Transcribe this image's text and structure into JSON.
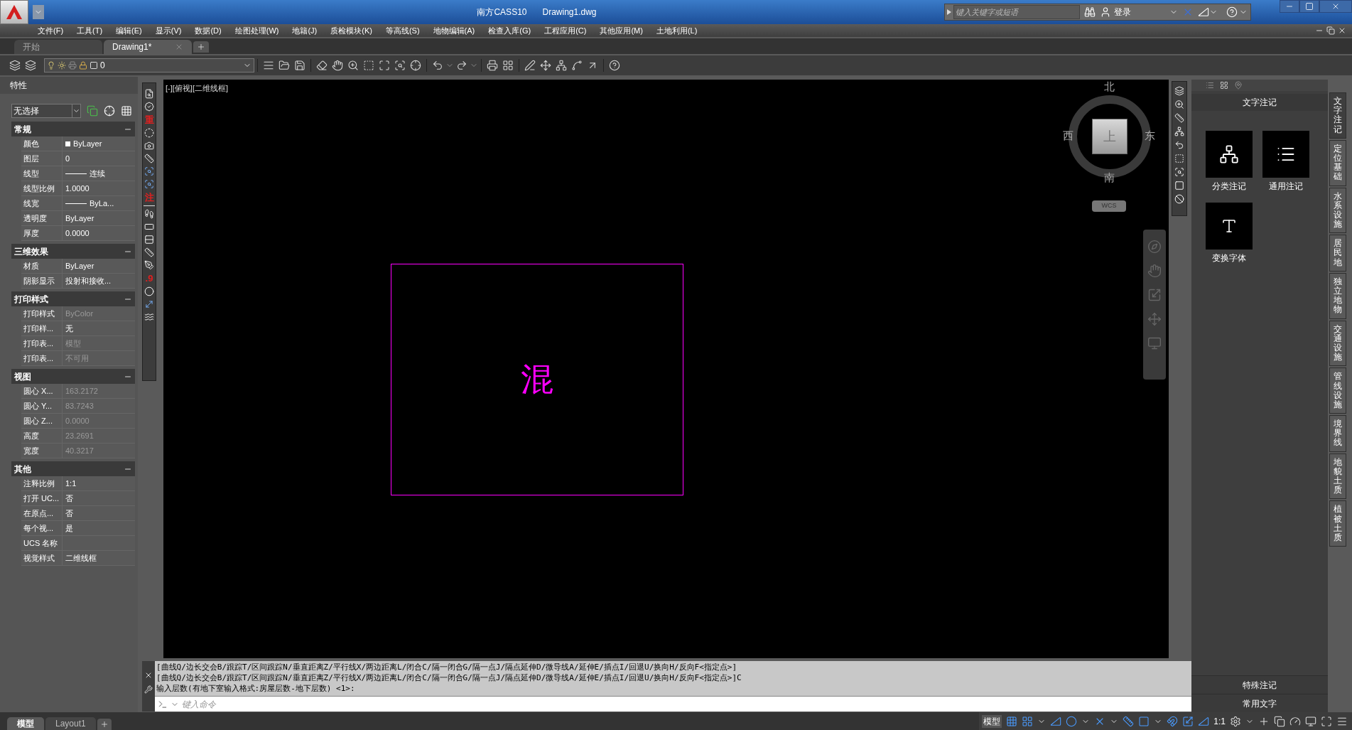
{
  "title_bar": {
    "app_name": "南方CASS10",
    "file_name": "Drawing1.dwg",
    "search_placeholder": "键入关键字或短语",
    "login": "登录"
  },
  "menu": [
    "文件(F)",
    "工具(T)",
    "编辑(E)",
    "显示(V)",
    "数据(D)",
    "绘图处理(W)",
    "地籍(J)",
    "质检模块(K)",
    "等高线(S)",
    "地物编辑(A)",
    "检查入库(G)",
    "工程应用(C)",
    "其他应用(M)",
    "土地利用(L)"
  ],
  "doc_tabs": [
    {
      "label": "开始",
      "selected": false
    },
    {
      "label": "Drawing1*",
      "selected": true
    }
  ],
  "layer_dropdown": {
    "value": "0"
  },
  "properties": {
    "title": "特性",
    "selection": "无选择",
    "sections": [
      {
        "title": "常规",
        "expanded": true,
        "rows": [
          {
            "label": "颜色",
            "value": "ByLayer",
            "kind": "color",
            "dimmed": false
          },
          {
            "label": "图层",
            "value": "0",
            "kind": "text",
            "dimmed": false
          },
          {
            "label": "线型",
            "value": "连续",
            "kind": "line",
            "dimmed": false
          },
          {
            "label": "线型比例",
            "value": "1.0000",
            "kind": "text",
            "dimmed": false
          },
          {
            "label": "线宽",
            "value": "ByLa...",
            "kind": "line",
            "dimmed": false
          },
          {
            "label": "透明度",
            "value": "ByLayer",
            "kind": "text",
            "dimmed": false
          },
          {
            "label": "厚度",
            "value": "0.0000",
            "kind": "text",
            "dimmed": false
          }
        ]
      },
      {
        "title": "三维效果",
        "expanded": true,
        "rows": [
          {
            "label": "材质",
            "value": "ByLayer",
            "kind": "text",
            "dimmed": false
          },
          {
            "label": "阴影显示",
            "value": "投射和接收...",
            "kind": "text",
            "dimmed": false
          }
        ]
      },
      {
        "title": "打印样式",
        "expanded": true,
        "rows": [
          {
            "label": "打印样式",
            "value": "ByColor",
            "kind": "text",
            "dimmed": true
          },
          {
            "label": "打印样...",
            "value": "无",
            "kind": "text",
            "dimmed": false
          },
          {
            "label": "打印表...",
            "value": "模型",
            "kind": "text",
            "dimmed": true
          },
          {
            "label": "打印表...",
            "value": "不可用",
            "kind": "text",
            "dimmed": true
          }
        ]
      },
      {
        "title": "视图",
        "expanded": true,
        "rows": [
          {
            "label": "圆心 X...",
            "value": "163.2172",
            "kind": "text",
            "dimmed": true
          },
          {
            "label": "圆心 Y...",
            "value": "83.7243",
            "kind": "text",
            "dimmed": true
          },
          {
            "label": "圆心 Z...",
            "value": "0.0000",
            "kind": "text",
            "dimmed": true
          },
          {
            "label": "高度",
            "value": "23.2691",
            "kind": "text",
            "dimmed": true
          },
          {
            "label": "宽度",
            "value": "40.3217",
            "kind": "text",
            "dimmed": true
          }
        ]
      },
      {
        "title": "其他",
        "expanded": true,
        "rows": [
          {
            "label": "注释比例",
            "value": "1:1",
            "kind": "text",
            "dimmed": false
          },
          {
            "label": "打开 UC...",
            "value": "否",
            "kind": "text",
            "dimmed": false
          },
          {
            "label": "在原点...",
            "value": "否",
            "kind": "text",
            "dimmed": false
          },
          {
            "label": "每个视...",
            "value": "是",
            "kind": "text",
            "dimmed": false
          },
          {
            "label": "UCS 名称",
            "kind": "text",
            "dimmed": false
          },
          {
            "label": "视觉样式",
            "value": "二维线框",
            "kind": "text",
            "dimmed": false
          }
        ]
      }
    ]
  },
  "tool_glyphs": [
    "重",
    "注",
    ".9"
  ],
  "viewport_label": "[-][俯视][二维线框]",
  "viewcube": {
    "north": "北",
    "south": "南",
    "west": "西",
    "east": "东",
    "top": "上",
    "ucs": "WCS"
  },
  "drawing_text": "混",
  "right_panel": {
    "heading": "文字注记",
    "tools": [
      {
        "label": "分类注记",
        "kind": "tree"
      },
      {
        "label": "通用注记",
        "kind": "list"
      },
      {
        "label": "变换字体",
        "kind": "font"
      }
    ],
    "footers": [
      "特殊注记",
      "常用文字"
    ]
  },
  "side_tabs": [
    {
      "label": "文字注记",
      "selected": true
    },
    {
      "label": "定位基础",
      "selected": false
    },
    {
      "label": "水系设施",
      "selected": false
    },
    {
      "label": "居民地",
      "selected": false
    },
    {
      "label": "独立地物",
      "selected": false
    },
    {
      "label": "交通设施",
      "selected": false
    },
    {
      "label": "管线设施",
      "selected": false
    },
    {
      "label": "境界线",
      "selected": false
    },
    {
      "label": "地貌土质",
      "selected": false
    },
    {
      "label": "植被土质",
      "selected": false
    }
  ],
  "command": {
    "history": [
      "[曲线Q/边长交会B/跟踪T/区间跟踪N/垂直距离Z/平行线X/两边距离L/闭合C/隔一闭合G/隔一点J/隔点延伸D/微导线A/延伸E/插点I/回退U/换向H/反向F<指定点>]",
      "[曲线Q/边长交会B/跟踪T/区间跟踪N/垂直距离Z/平行线X/两边距离L/闭合C/隔一闭合G/隔一点J/隔点延伸D/微导线A/延伸E/插点I/回退U/换向H/反向F<指定点>]C",
      "输入层数(有地下室输入格式:房屋层数-地下层数) <1>:"
    ],
    "placeholder": "键入命令"
  },
  "layout_tabs": [
    {
      "label": "模型",
      "selected": true
    },
    {
      "label": "Layout1",
      "selected": false
    }
  ],
  "status_bar": {
    "model": "模型",
    "scale": "1:1"
  }
}
